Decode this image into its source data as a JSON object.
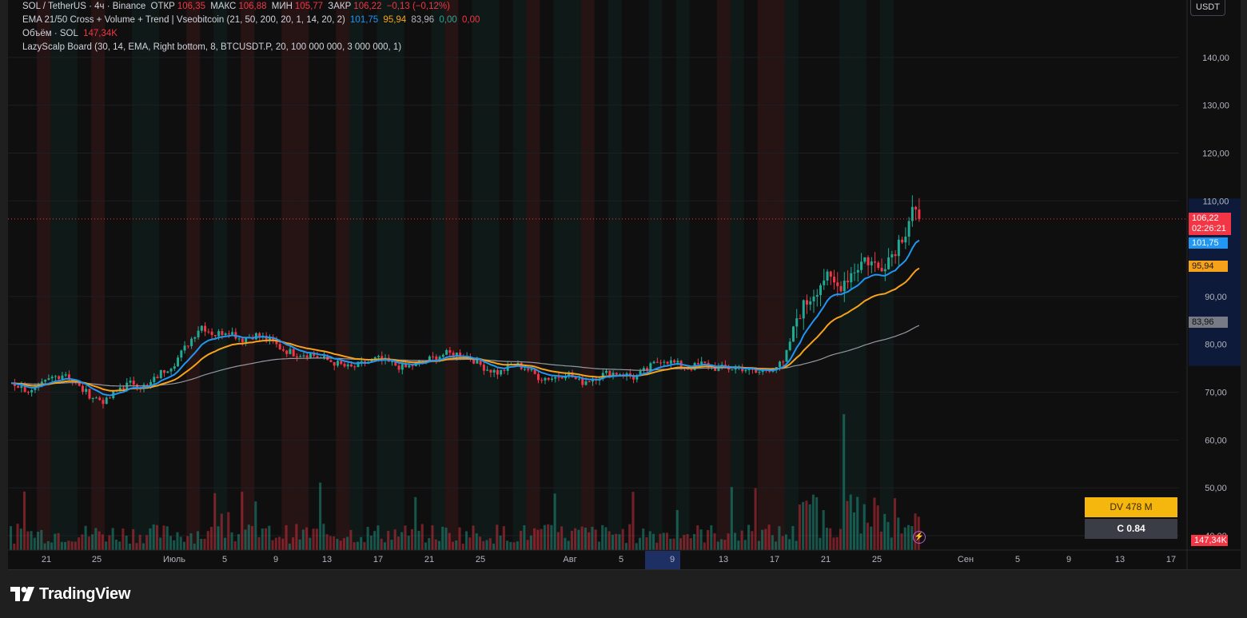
{
  "legend": {
    "symbol_line": "SOL / TetherUS · 4ч · Binance",
    "open_label": "ОТКР",
    "open": "106,35",
    "high_label": "МАКС",
    "high": "106,88",
    "low_label": "МИН",
    "low": "105,77",
    "close_label": "ЗАКР",
    "close": "106,22",
    "change": "−0,13 (−0,12%)",
    "ema_name": "EMA 21/50 Cross + Volume + Trend | Vseobitcoin (21, 50, 200, 20, 1, 14, 20, 2)",
    "ema_fast": "101,75",
    "ema_slow": "95,94",
    "ema_long": "83,96",
    "ema_v1": "0,00",
    "ema_v2": "0,00",
    "volume_name": "Объём · SOL",
    "volume_value": "147,34K",
    "lazy_name": "LazyScalp Board (30, 14, EMA, Right bottom, 8, BTCUSDT.P, 20, 100 000 000, 3 000 000, 1)"
  },
  "currency": "USDT",
  "price_tags": {
    "last_price": "106,22",
    "countdown": "02:26:21",
    "ema_fast": "101,75",
    "ema_slow": "95,94",
    "ema_long": "83,96",
    "volume": "147,34K"
  },
  "board": {
    "dv": "DV 478 M",
    "c": "C  0.84"
  },
  "brand": "TradingView",
  "colors": {
    "up": "#22ab94",
    "down": "#f23645",
    "ema_fast": "#2196f3",
    "ema_slow": "#f7a21b",
    "ema_long": "#9598a1",
    "panel_bg": "#0f0f0f",
    "board_dv": "#f5b60d",
    "board_c": "#3a3d46"
  },
  "icons": [
    "tradingview-logo-icon",
    "lightning-icon"
  ],
  "chart_data": {
    "type": "candlestick",
    "title": "SOL / TetherUS · 4ч · Binance",
    "y_ticks": [
      "140,00",
      "130,00",
      "120,00",
      "110,00",
      "90,00",
      "80,00",
      "70,00",
      "60,00",
      "50,00",
      "40,00"
    ],
    "ylim": [
      37,
      152
    ],
    "x_ticks": [
      "21",
      "25",
      "Июль",
      "5",
      "9",
      "13",
      "17",
      "21",
      "25",
      "Авг",
      "5",
      "9",
      "13",
      "17",
      "21",
      "25",
      "Сен",
      "5",
      "9",
      "13",
      "17"
    ],
    "highlighted_x_tick": "9",
    "grid": true,
    "price_path": [
      [
        0,
        72
      ],
      [
        3,
        70
      ],
      [
        6,
        73
      ],
      [
        8,
        74
      ],
      [
        10,
        71
      ],
      [
        12,
        69
      ],
      [
        14,
        68
      ],
      [
        16,
        71
      ],
      [
        18,
        72
      ],
      [
        20,
        71
      ],
      [
        22,
        74
      ],
      [
        24,
        76
      ],
      [
        26,
        80
      ],
      [
        28,
        84
      ],
      [
        30,
        82
      ],
      [
        32,
        83
      ],
      [
        34,
        81
      ],
      [
        36,
        82
      ],
      [
        38,
        81
      ],
      [
        40,
        79
      ],
      [
        42,
        78
      ],
      [
        44,
        78
      ],
      [
        46,
        77
      ],
      [
        48,
        76
      ],
      [
        50,
        75
      ],
      [
        52,
        76
      ],
      [
        54,
        77
      ],
      [
        56,
        76
      ],
      [
        58,
        75
      ],
      [
        60,
        76
      ],
      [
        62,
        77
      ],
      [
        64,
        78
      ],
      [
        66,
        78
      ],
      [
        68,
        77
      ],
      [
        70,
        75
      ],
      [
        72,
        74
      ],
      [
        74,
        76
      ],
      [
        76,
        75
      ],
      [
        78,
        73
      ],
      [
        80,
        73
      ],
      [
        82,
        74
      ],
      [
        84,
        72
      ],
      [
        86,
        73
      ],
      [
        88,
        74
      ],
      [
        90,
        74
      ],
      [
        92,
        73
      ],
      [
        94,
        75
      ],
      [
        96,
        77
      ],
      [
        98,
        76
      ],
      [
        100,
        75
      ],
      [
        102,
        76
      ],
      [
        104,
        75
      ],
      [
        106,
        75
      ],
      [
        108,
        75
      ],
      [
        110,
        74
      ],
      [
        112,
        75
      ],
      [
        114,
        76
      ],
      [
        116,
        86
      ],
      [
        118,
        90
      ],
      [
        120,
        94
      ],
      [
        122,
        92
      ],
      [
        124,
        95
      ],
      [
        126,
        98
      ],
      [
        128,
        96
      ],
      [
        130,
        99
      ],
      [
        132,
        104
      ],
      [
        133,
        109
      ],
      [
        134,
        106.22
      ]
    ],
    "ema_fast_last": 101.75,
    "ema_slow_last": 95.94,
    "ema_long_last": 83.96,
    "volume_last": "147,34K",
    "last_close": 106.22
  }
}
